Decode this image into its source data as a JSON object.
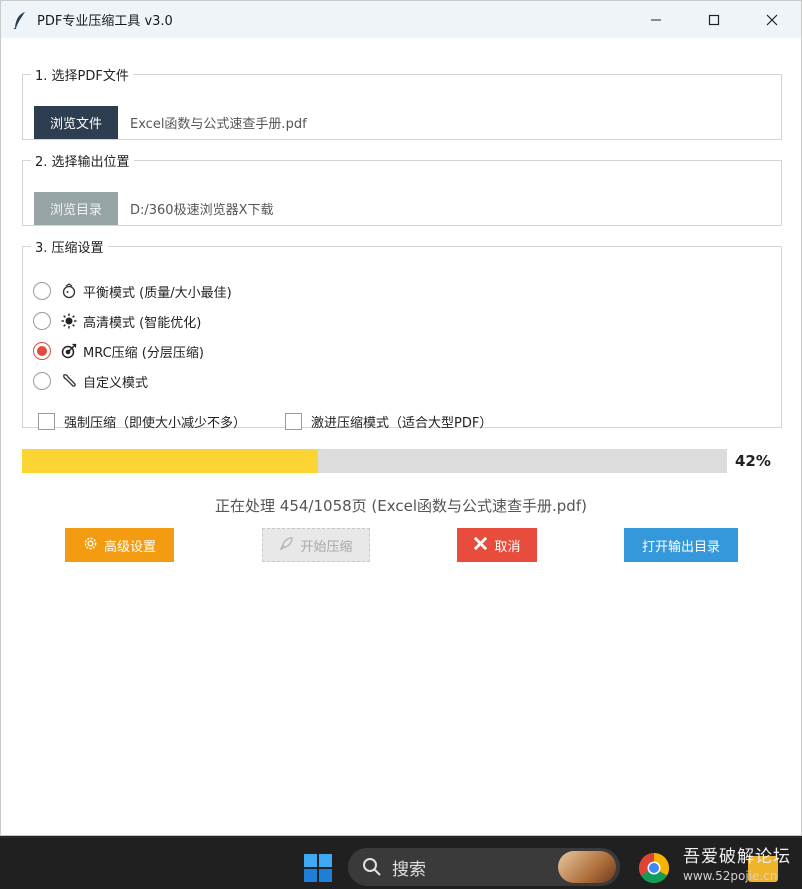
{
  "window": {
    "title": "PDF专业压缩工具 v3.0",
    "controls": [
      "minimize-icon",
      "maximize-icon",
      "close-icon"
    ]
  },
  "section1": {
    "legend": "1. 选择PDF文件",
    "browse_label": "浏览文件",
    "file_name": "Excel函数与公式速查手册.pdf"
  },
  "section2": {
    "legend": "2. 选择输出位置",
    "browse_label": "浏览目录",
    "output_path": "D:/360极速浏览器X下载"
  },
  "section3": {
    "legend": "3. 压缩设置",
    "modes": [
      {
        "label": "平衡模式 (质量/大小最佳)",
        "icon": "balance-icon",
        "checked": false
      },
      {
        "label": "高清模式 (智能优化)",
        "icon": "sun-icon",
        "checked": false
      },
      {
        "label": "MRC压缩 (分层压缩)",
        "icon": "target-icon",
        "checked": true
      },
      {
        "label": "自定义模式",
        "icon": "wrench-icon",
        "checked": false
      }
    ],
    "checks": [
      {
        "label": "强制压缩（即使大小减少不多）",
        "checked": false
      },
      {
        "label": "激进压缩模式（适合大型PDF）",
        "checked": false
      }
    ]
  },
  "progress": {
    "value": 0.42,
    "percent_label": "42%",
    "status": "正在处理 454/1058页 (Excel函数与公式速查手册.pdf)"
  },
  "actions": {
    "advanced_label": "高级设置",
    "start_label": "开始压缩",
    "cancel_label": "取消",
    "open_label": "打开输出目录"
  },
  "taskbar": {
    "search_label": "搜索",
    "watermark_line1": "吾爱破解论坛",
    "watermark_line2": "www.52pojie.cn"
  },
  "colors": {
    "accent_red": "#e74c3c",
    "accent_orange": "#f39c12",
    "accent_blue": "#3498db",
    "progress_yellow": "#fcd535",
    "dark_button": "#2d3e50"
  }
}
